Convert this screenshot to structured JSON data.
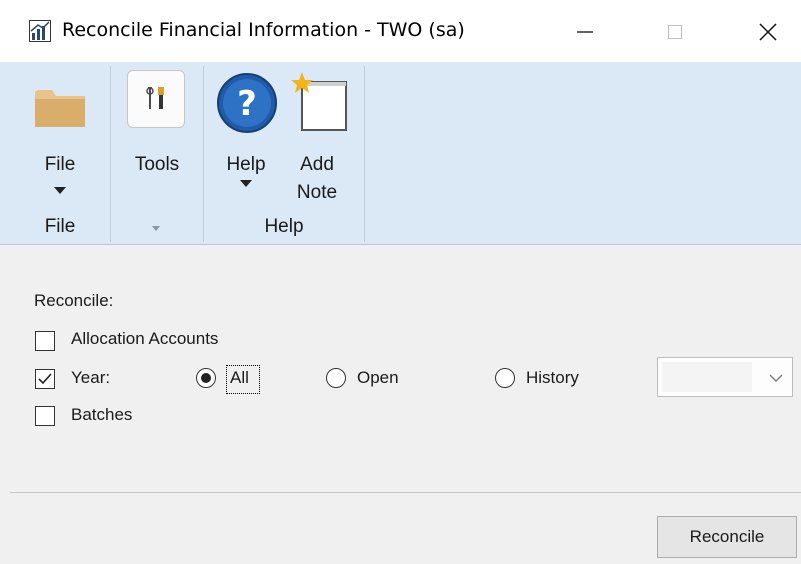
{
  "window": {
    "title": "Reconcile Financial Information  -  TWO (sa)",
    "controls": [
      "minimize-icon",
      "maximize-icon",
      "close-icon"
    ]
  },
  "ribbon": {
    "groups": [
      {
        "name": "File",
        "buttons": [
          {
            "label": "File",
            "icon": "folder-icon",
            "has_dropdown": true
          }
        ]
      },
      {
        "name": "",
        "buttons": [
          {
            "label": "Tools",
            "icon": "tools-icon",
            "has_dropdown": false
          }
        ],
        "has_dropdown": true
      },
      {
        "name": "Help",
        "buttons": [
          {
            "label": "Help",
            "icon": "help-icon",
            "has_dropdown": true
          },
          {
            "label_line1": "Add",
            "label_line2": "Note",
            "icon": "note-icon"
          }
        ]
      }
    ],
    "file_label": "File",
    "file_group": "File",
    "tools_label": "Tools",
    "help_label": "Help",
    "add_note_line1": "Add",
    "add_note_line2": "Note",
    "help_group": "Help"
  },
  "form": {
    "section_label": "Reconcile:",
    "allocation_label": "Allocation Accounts",
    "allocation_checked": false,
    "year_label": "Year:",
    "year_checked": true,
    "year_options": {
      "all": "All",
      "open": "Open",
      "history": "History"
    },
    "year_selected": "All",
    "batches_label": "Batches",
    "batches_checked": false,
    "history_year_value": ""
  },
  "footer": {
    "reconcile_button": "Reconcile"
  },
  "colors": {
    "ribbon_bg": "#dbe8f5",
    "body_bg": "#f0f0f0"
  }
}
